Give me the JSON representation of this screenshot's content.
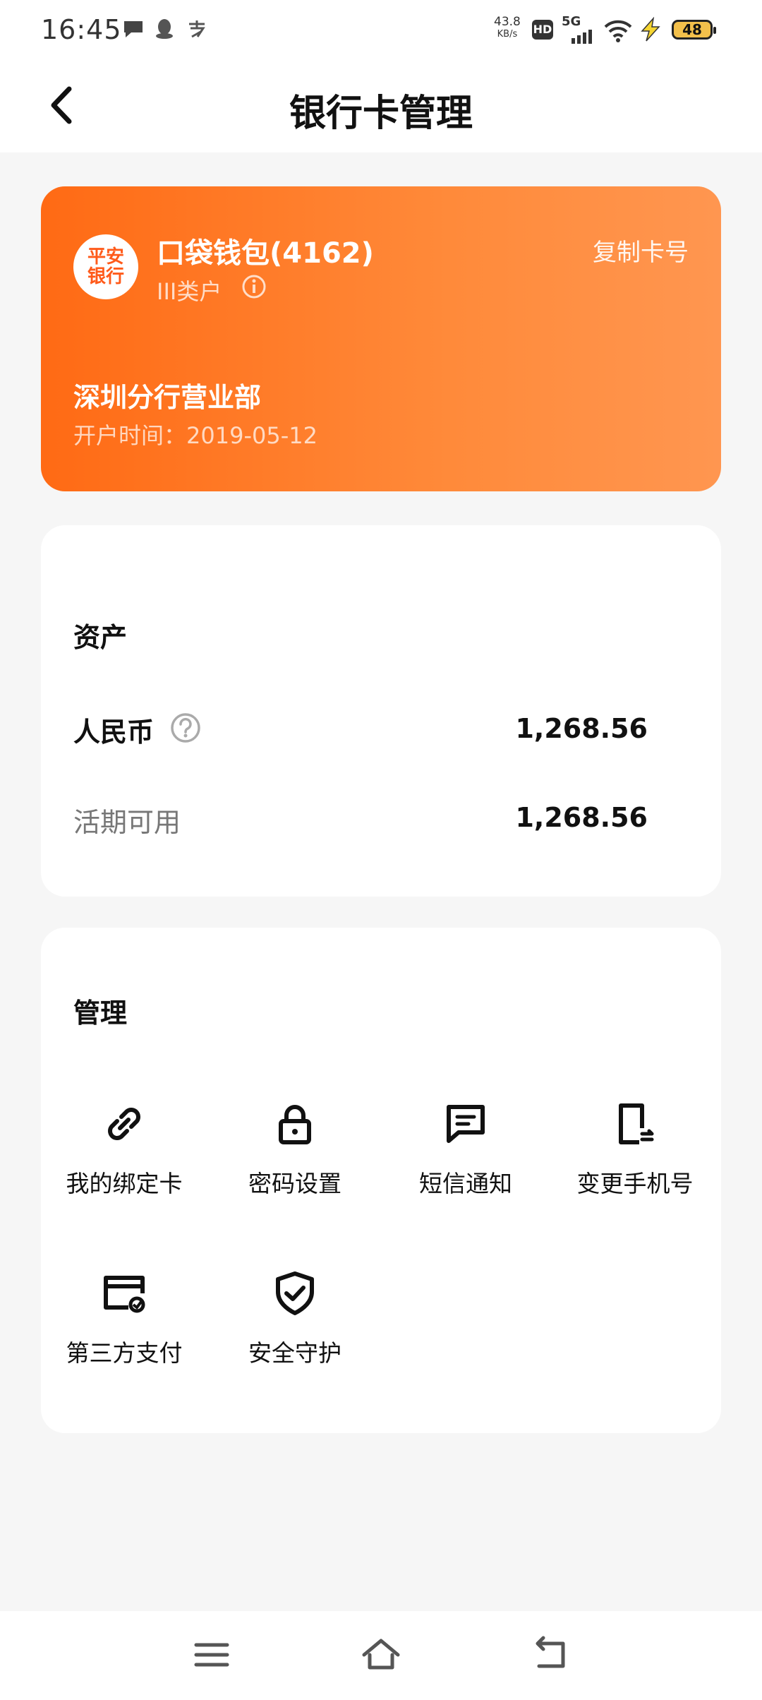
{
  "status_bar": {
    "time": "16:45",
    "net_speed_value": "43.8",
    "net_speed_unit": "KB/s",
    "hd": "HD",
    "network": "5G",
    "battery": "48"
  },
  "header": {
    "title": "银行卡管理",
    "back_icon": "chevron-left-icon"
  },
  "card": {
    "logo_line1": "平安",
    "logo_line2": "银行",
    "name": "口袋钱包(4162)",
    "account_type": "III类户",
    "copy_label": "复制卡号",
    "branch": "深圳分行营业部",
    "open_date": "开户时间：2019-05-12",
    "gradient_start": "#ff6a14",
    "gradient_end": "#ff9650"
  },
  "assets": {
    "title": "资产",
    "currency_label": "人民币",
    "currency_value": "1,268.56",
    "available_label": "活期可用",
    "available_value": "1,268.56"
  },
  "manage": {
    "title": "管理",
    "items": [
      {
        "label": "我的绑定卡",
        "icon": "link-icon"
      },
      {
        "label": "密码设置",
        "icon": "lock-icon"
      },
      {
        "label": "短信通知",
        "icon": "message-icon"
      },
      {
        "label": "变更手机号",
        "icon": "phone-swap-icon"
      },
      {
        "label": "第三方支付",
        "icon": "card-link-icon"
      },
      {
        "label": "安全守护",
        "icon": "shield-check-icon"
      }
    ]
  },
  "nav": {
    "menu_icon": "menu-icon",
    "home_icon": "home-icon",
    "back_icon": "back-icon"
  }
}
